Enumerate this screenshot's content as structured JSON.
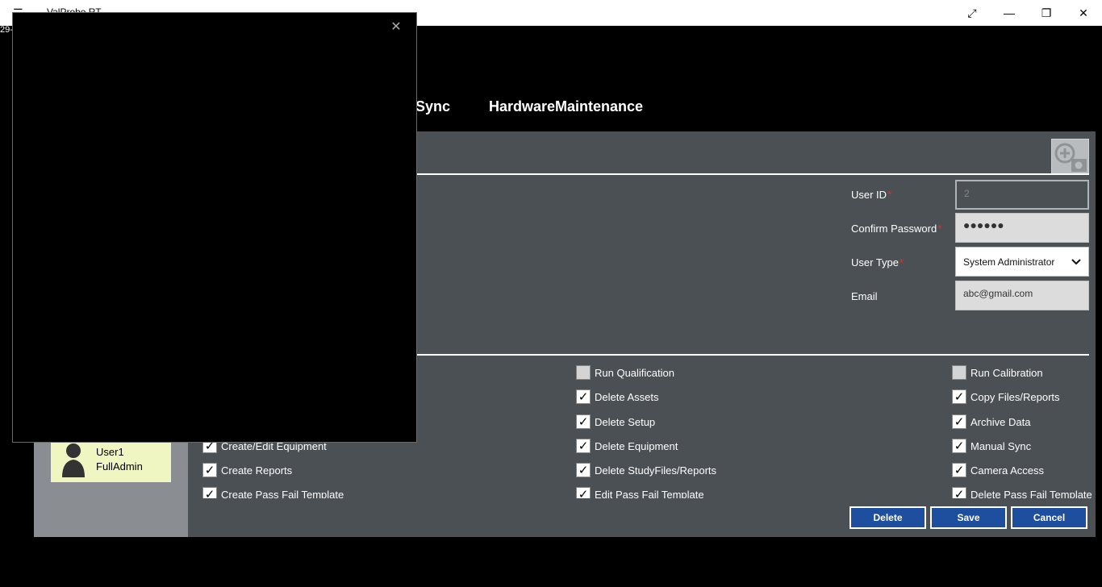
{
  "window": {
    "title": "ValProbe RT",
    "date_fragment": "29-"
  },
  "nav": {
    "tabs": [
      {
        "label": "toSync"
      },
      {
        "label": "HardwareMaintenance"
      }
    ]
  },
  "form": {
    "user_id": {
      "label": "User ID",
      "value": "2"
    },
    "confirm_password": {
      "label": "Confirm Password",
      "value": "●●●●●●"
    },
    "user_type": {
      "label": "User Type",
      "value": "System Administrator"
    },
    "email": {
      "label": "Email",
      "value": "abc@gmail.com"
    },
    "required_mark": "*"
  },
  "permissions": {
    "col1": [
      {
        "label": "Create/Edit Equipment",
        "checked": true
      },
      {
        "label": "Create Reports",
        "checked": true
      },
      {
        "label": "Create Pass Fail Template",
        "checked": true
      }
    ],
    "col2": [
      {
        "label": "Run Qualification",
        "checked": false
      },
      {
        "label": "Delete Assets",
        "checked": true
      },
      {
        "label": "Delete Setup",
        "checked": true
      },
      {
        "label": "Delete Equipment",
        "checked": true
      },
      {
        "label": "Delete StudyFiles/Reports",
        "checked": true
      },
      {
        "label": "Edit Pass Fail Template",
        "checked": true
      }
    ],
    "col3": [
      {
        "label": "Run Calibration",
        "checked": false
      },
      {
        "label": "Copy Files/Reports",
        "checked": true
      },
      {
        "label": "Archive Data",
        "checked": true
      },
      {
        "label": "Manual Sync",
        "checked": true
      },
      {
        "label": "Camera Access",
        "checked": true
      },
      {
        "label": "Delete Pass Fail Template",
        "checked": true
      }
    ]
  },
  "user_card": {
    "name": "User1",
    "role": "FullAdmin"
  },
  "actions": {
    "delete": "Delete",
    "save": "Save",
    "cancel": "Cancel"
  },
  "icons": {
    "hamburger": "hamburger-icon",
    "expand": "expand-icon",
    "minimize": "minimize-icon",
    "maximize": "restore-icon",
    "close": "close-icon",
    "camera": "add-camera-icon",
    "avatar": "user-avatar-icon",
    "dropdown": "chevron-down-icon"
  },
  "colors": {
    "panel": "#4b5054",
    "button": "#1e4f9e",
    "user_card": "#f0f6c2",
    "required": "#d9342b"
  }
}
